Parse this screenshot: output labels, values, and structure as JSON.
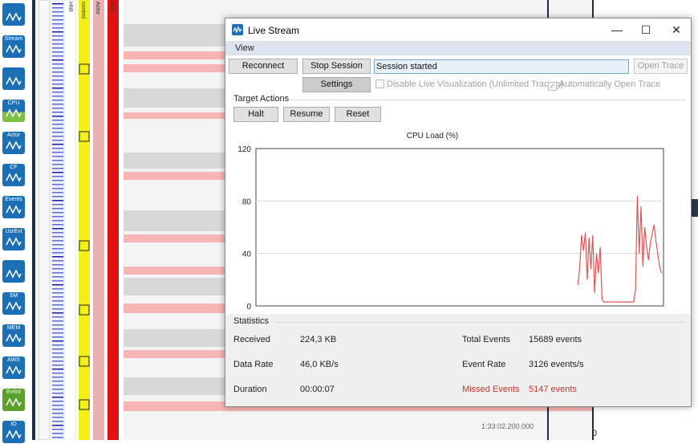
{
  "window": {
    "title": "Live Stream",
    "app_icon": "live-stream-icon",
    "controls": {
      "minimize": "—",
      "maximize": "☐",
      "close": "✕"
    }
  },
  "menu": {
    "view": "View"
  },
  "toolbar": {
    "reconnect": "Reconnect",
    "stop_session": "Stop Session",
    "status_text": "Session started",
    "open_trace": "Open Trace",
    "settings": "Settings",
    "disable_live_visualization": "Disable Live Visualization (Unlimited Tracing)",
    "disable_live_visualization_checked": false,
    "auto_open_trace": "Automatically Open Trace",
    "auto_open_trace_checked": true
  },
  "target_actions": {
    "title": "Target Actions",
    "halt": "Halt",
    "resume": "Resume",
    "reset": "Reset"
  },
  "chart_data": {
    "type": "line",
    "title": "CPU Load (%)",
    "xlabel": "",
    "ylabel": "",
    "ylim": [
      0,
      120
    ],
    "yticks": [
      "0",
      "40",
      "80",
      "120"
    ],
    "grid": true,
    "series": [
      {
        "color": "#e05555",
        "x": [
          0,
          1,
          2,
          3,
          4,
          5,
          6,
          7,
          8,
          9,
          10,
          11,
          12,
          13,
          14,
          15,
          16,
          17,
          18,
          19,
          20,
          21,
          22,
          23,
          24,
          25,
          26,
          27,
          28,
          29,
          30,
          31,
          32,
          33,
          34,
          35,
          36,
          37,
          38,
          39,
          40,
          41,
          42,
          43,
          44,
          45
        ],
        "values": [
          16,
          30,
          54,
          42,
          56,
          20,
          52,
          28,
          54,
          10,
          40,
          25,
          45,
          5,
          3,
          3,
          3,
          3,
          3,
          3,
          3,
          3,
          3,
          3,
          3,
          3,
          3,
          3,
          3,
          3,
          3,
          12,
          84,
          40,
          76,
          30,
          60,
          45,
          35,
          48,
          55,
          62,
          50,
          40,
          30,
          25
        ]
      }
    ]
  },
  "statistics": {
    "title": "Statistics",
    "received_label": "Received",
    "received_value": "224,3 KB",
    "data_rate_label": "Data Rate",
    "data_rate_value": "46,0 KB/s",
    "duration_label": "Duration",
    "duration_value": "00:00:07",
    "total_events_label": "Total Events",
    "total_events_value": "15689 events",
    "event_rate_label": "Event Rate",
    "event_rate_value": "3126 events/s",
    "missed_events_label": "Missed Events",
    "missed_events_value": "5147 events"
  },
  "background": {
    "sidebar_buttons": [
      {
        "label": "",
        "icon": "dashboard-icon"
      },
      {
        "label": "Stream",
        "icon": "stream-icon"
      },
      {
        "label": "",
        "icon": "trace-view-icon"
      },
      {
        "label": "CPU",
        "icon": "cpu-icon"
      },
      {
        "label": "Actor",
        "icon": "actor-icon"
      },
      {
        "label": "CF",
        "icon": "call-flow-icon"
      },
      {
        "label": "Events",
        "icon": "events-icon"
      },
      {
        "label": "UsrEvt",
        "icon": "user-events-icon"
      },
      {
        "label": "",
        "icon": "dependency-icon"
      },
      {
        "label": "SM",
        "icon": "state-machine-icon"
      },
      {
        "label": "MEM",
        "icon": "memory-icon"
      },
      {
        "label": "AWS",
        "icon": "aws-icon"
      },
      {
        "label": "EvtInt",
        "icon": "event-intensity-icon"
      },
      {
        "label": "IO",
        "icon": "io-icon"
      }
    ],
    "column_headers": [
      "HMI",
      "control",
      "Actor",
      "ADC"
    ],
    "timestamp": "1:33:02.200.000",
    "zero_label": "0"
  }
}
